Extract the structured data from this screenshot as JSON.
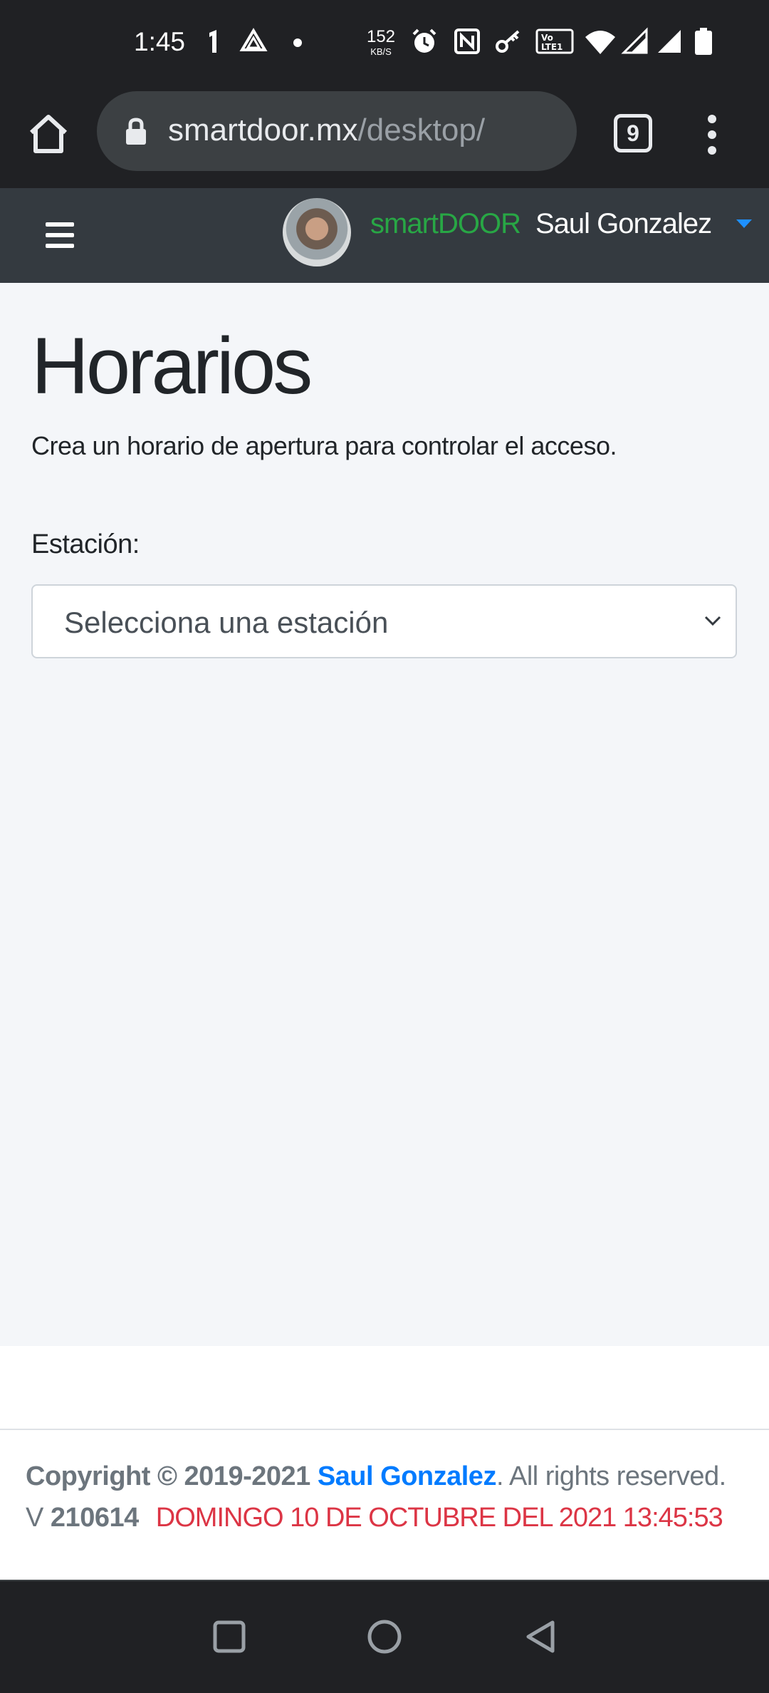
{
  "status_bar": {
    "time": "1:45",
    "net_speed_value": "152",
    "net_speed_unit": "KB/S",
    "icons": [
      "notification-icon",
      "drive-icon",
      "dot-icon",
      "alarm-icon",
      "nfc-icon",
      "key-icon",
      "volte-icon",
      "wifi-icon",
      "signal-icon",
      "signal-icon",
      "battery-icon"
    ]
  },
  "browser": {
    "url_host": "smartdoor.mx",
    "url_path": "/desktop/",
    "tab_count": "9"
  },
  "app_nav": {
    "brand": "smartDOOR",
    "user_name": "Saul Gonzalez",
    "brand_color": "#28a745"
  },
  "page": {
    "title": "Horarios",
    "subtitle": "Crea un horario de apertura para controlar el acceso.",
    "station_label": "Estación:",
    "station_placeholder": "Selecciona una estación"
  },
  "footer": {
    "copyright_prefix": "Copyright © 2019-2021 ",
    "author": "Saul Gonzalez",
    "rights": ". All rights reserved.",
    "version_label": "V",
    "version": "210614",
    "datetime": "DOMINGO 10 DE OCTUBRE DEL 2021 13:45:53",
    "datetime_color": "#dc3545",
    "link_color": "#007bff"
  }
}
